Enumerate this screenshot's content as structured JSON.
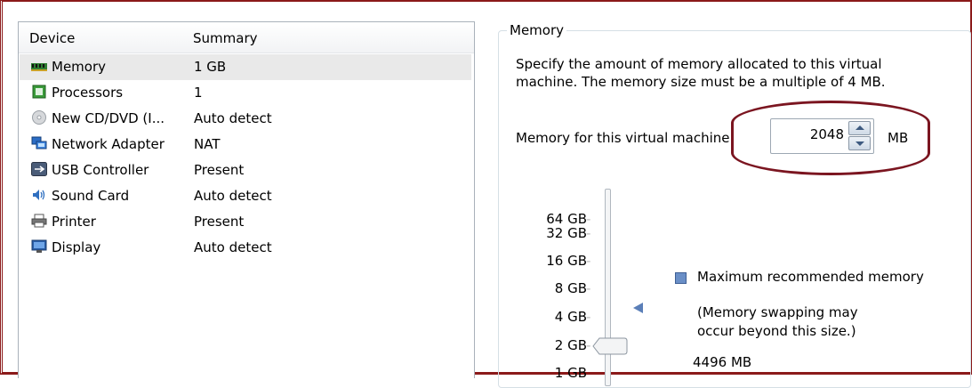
{
  "device_list": {
    "columns": [
      "Device",
      "Summary"
    ],
    "devices": [
      {
        "name": "Memory",
        "summary": "1 GB",
        "icon": "memory-icon",
        "selected": true
      },
      {
        "name": "Processors",
        "summary": "1",
        "icon": "processor-icon"
      },
      {
        "name": "New CD/DVD (I...",
        "summary": "Auto detect",
        "icon": "cd-dvd-icon"
      },
      {
        "name": "Network Adapter",
        "summary": "NAT",
        "icon": "network-adapter-icon"
      },
      {
        "name": "USB Controller",
        "summary": "Present",
        "icon": "usb-icon"
      },
      {
        "name": "Sound Card",
        "summary": "Auto detect",
        "icon": "speaker-icon"
      },
      {
        "name": "Printer",
        "summary": "Present",
        "icon": "printer-icon"
      },
      {
        "name": "Display",
        "summary": "Auto detect",
        "icon": "monitor-icon"
      }
    ]
  },
  "memory": {
    "group_title": "Memory",
    "description": "Specify the amount of memory allocated to this virtual machine. The memory size must be a multiple of 4 MB.",
    "field_label": "Memory for this virtual machine:",
    "value": "2048",
    "unit": "MB",
    "scale_labels": [
      "64 GB",
      "32 GB",
      "16 GB",
      "8 GB",
      "4 GB",
      "2 GB",
      "1 GB"
    ],
    "max_recommended_label": "Maximum recommended memory",
    "swap_note_line1": "(Memory swapping may",
    "swap_note_line2": "occur beyond this size.)",
    "max_recommended_value": "4496 MB"
  },
  "colors": {
    "accent_frame": "#8b1a1a",
    "highlight": "#7b1520",
    "selection": "#e9e9e9",
    "legend_marker": "#6a8fc7"
  }
}
